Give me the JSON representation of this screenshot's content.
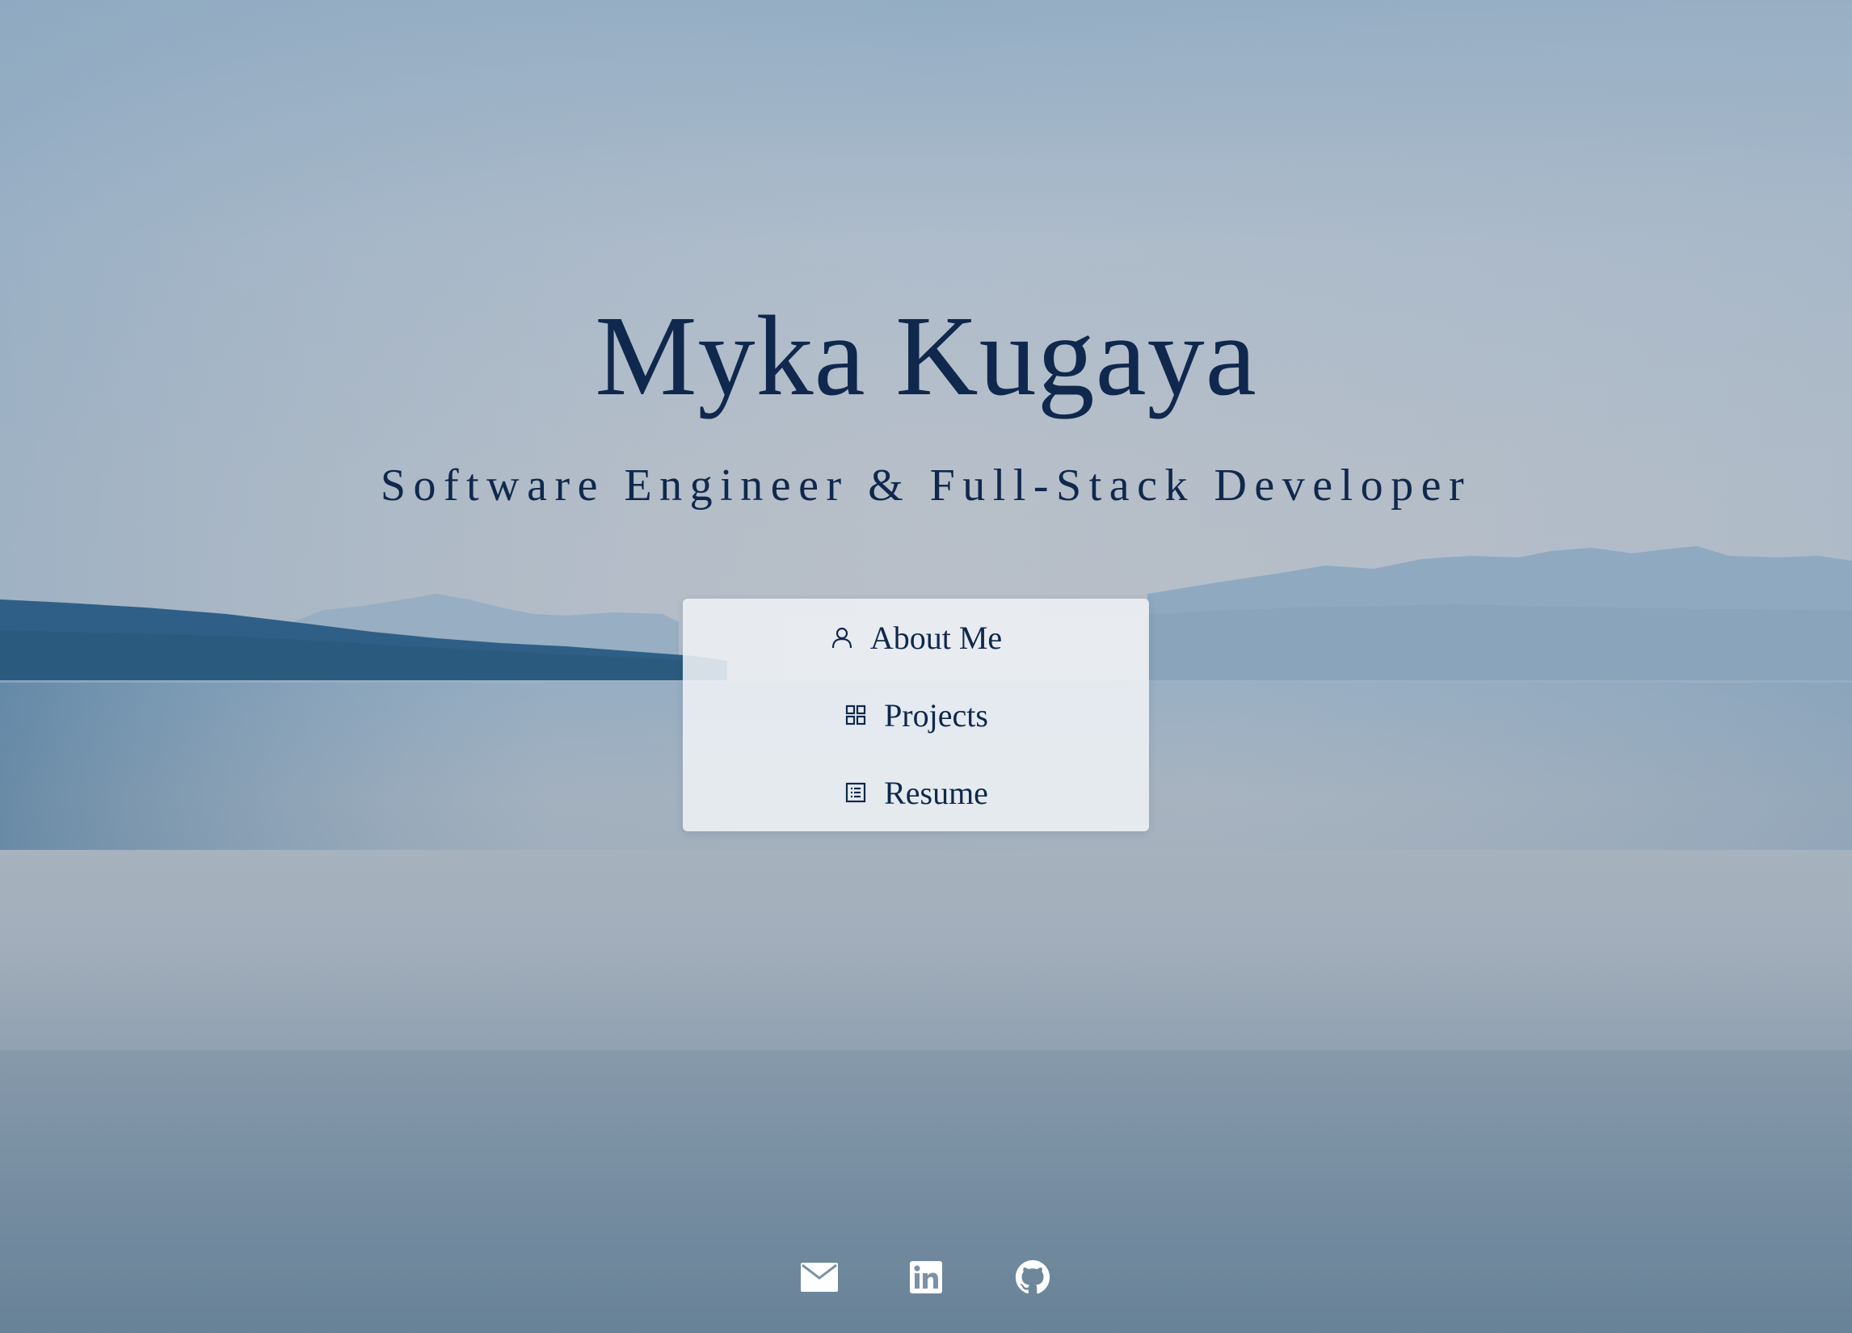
{
  "hero": {
    "name": "Myka Kugaya",
    "tagline": "Software Engineer & Full-Stack Developer"
  },
  "menu": {
    "items": [
      {
        "label": "About Me",
        "icon": "user-icon"
      },
      {
        "label": "Projects",
        "icon": "grid-icon"
      },
      {
        "label": "Resume",
        "icon": "list-icon"
      }
    ]
  },
  "socials": [
    {
      "icon": "mail-icon",
      "label": "Email"
    },
    {
      "icon": "linkedin-icon",
      "label": "LinkedIn"
    },
    {
      "icon": "github-icon",
      "label": "GitHub"
    }
  ],
  "colors": {
    "text": "#10284d",
    "menu_bg": "#eef1f5",
    "icon_white": "#ffffff"
  }
}
